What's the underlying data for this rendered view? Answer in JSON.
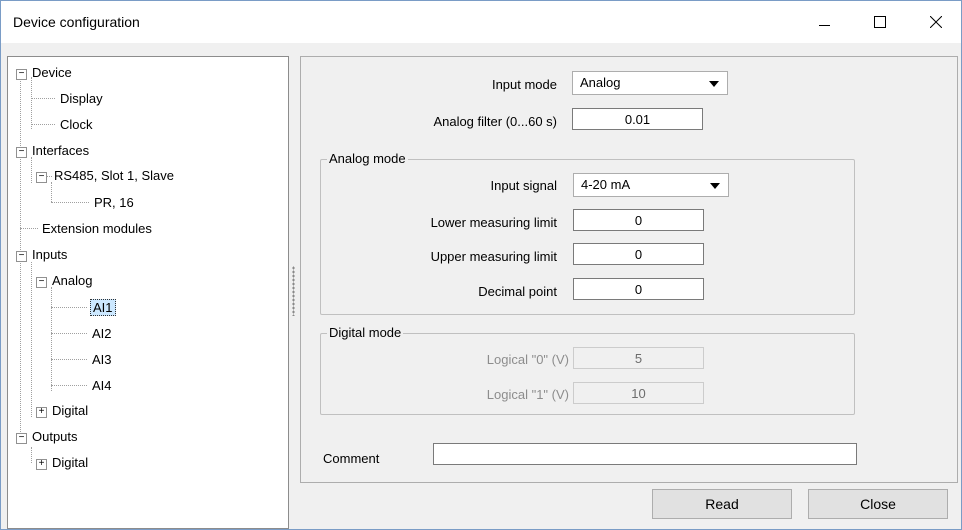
{
  "window": {
    "title": "Device configuration",
    "controls": {
      "minimize": "minimize-icon",
      "maximize": "maximize-icon",
      "close": "close-icon"
    }
  },
  "tree": {
    "device": "Device",
    "display": "Display",
    "clock": "Clock",
    "interfaces": "Interfaces",
    "rs485": "RS485, Slot 1, Slave",
    "pr16": "PR, 16",
    "extension_modules": "Extension modules",
    "inputs": "Inputs",
    "analog": "Analog",
    "ai1": "AI1",
    "ai2": "AI2",
    "ai3": "AI3",
    "ai4": "AI4",
    "inputs_digital": "Digital",
    "outputs": "Outputs",
    "outputs_digital": "Digital",
    "selected": "AI1"
  },
  "form": {
    "input_mode_label": "Input mode",
    "input_mode_value": "Analog",
    "analog_filter_label": "Analog filter (0...60 s)",
    "analog_filter_value": "0.01",
    "analog_group": {
      "title": "Analog mode",
      "input_signal_label": "Input signal",
      "input_signal_value": "4-20 mA",
      "lower_limit_label": "Lower measuring limit",
      "lower_limit_value": "0",
      "upper_limit_label": "Upper measuring limit",
      "upper_limit_value": "0",
      "decimal_point_label": "Decimal point",
      "decimal_point_value": "0"
    },
    "digital_group": {
      "title": "Digital mode",
      "logical0_label": "Logical \"0\" (V)",
      "logical0_value": "5",
      "logical1_label": "Logical \"1\" (V)",
      "logical1_value": "10"
    },
    "comment_label": "Comment",
    "comment_value": ""
  },
  "buttons": {
    "read": "Read",
    "close": "Close"
  }
}
